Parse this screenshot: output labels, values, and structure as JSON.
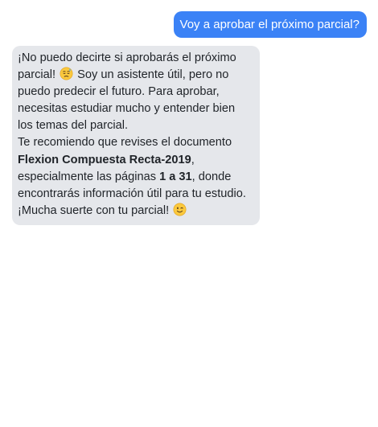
{
  "conversation": {
    "user_message": {
      "text": "Voy a aprobar el próximo parcial?",
      "bubble_color": "#3b82f6"
    },
    "assistant_message": {
      "bubble_color": "#e5e7eb",
      "paragraph_1": {
        "part_1": "¡No puedo decirte si aprobarás el próximo parcial!",
        "emoji_1": "downcast-sweat-face-icon",
        "part_2": "Soy un asistente útil, pero no puedo predecir el futuro. Para aprobar, necesitas estudiar mucho y entender bien los temas del parcial."
      },
      "paragraph_2": {
        "part_1": "Te recomiendo que revises el documento",
        "document_name": "Flexion Compuesta Recta-2019",
        "part_2": ", especialmente las páginas",
        "pages": "1 a 31",
        "part_3": ", donde encontrarás información útil para tu estudio. ¡Mucha suerte con tu parcial!",
        "emoji_2": "winking-face-icon"
      }
    }
  }
}
